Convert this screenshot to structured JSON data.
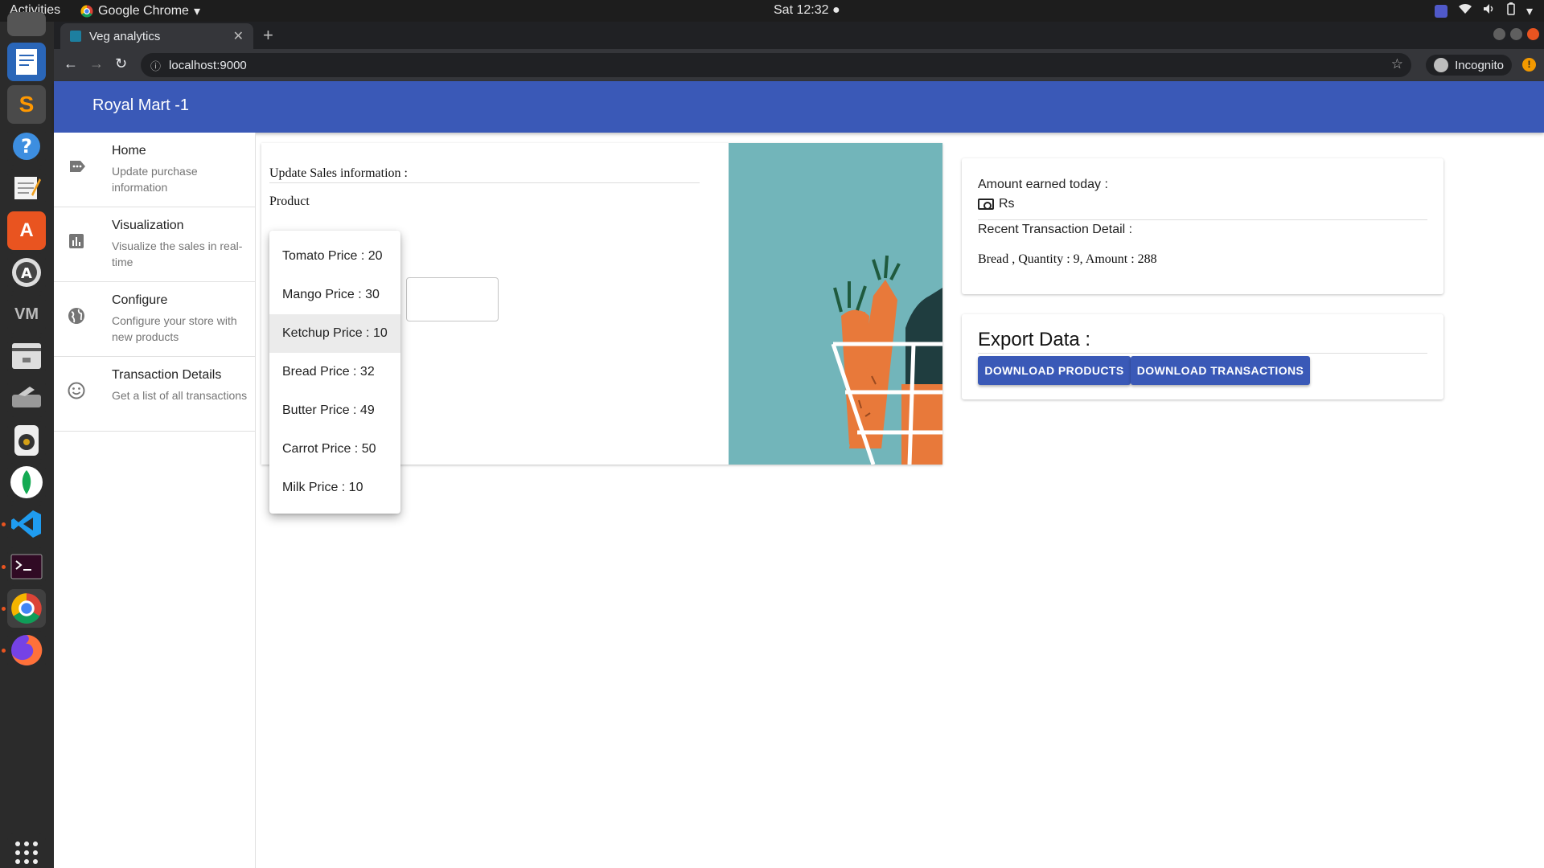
{
  "topbar": {
    "activities": "Activities",
    "app_name": "Google Chrome",
    "clock": "Sat 12:32"
  },
  "dock": {
    "items": [
      "text-editor",
      "sublime-text",
      "help",
      "notes",
      "software-center",
      "software-updater",
      "vim",
      "files",
      "scanner",
      "music",
      "mongodb",
      "vscode",
      "terminal",
      "chrome",
      "firefox",
      "apps-grid"
    ]
  },
  "browser": {
    "tab_title": "Veg analytics",
    "url": "localhost:9000",
    "incognito_label": "Incognito"
  },
  "app": {
    "title": "Royal Mart -1"
  },
  "nav": {
    "items": [
      {
        "title": "Home",
        "subtitle": "Update purchase information",
        "icon": "label-icon"
      },
      {
        "title": "Visualization",
        "subtitle": "Visualize the sales in real-time",
        "icon": "bar-chart-icon"
      },
      {
        "title": "Configure",
        "subtitle": "Configure your store with new products",
        "icon": "globe-icon"
      },
      {
        "title": "Transaction Details",
        "subtitle": "Get a list of all transactions",
        "icon": "smiley-icon"
      }
    ]
  },
  "sales": {
    "heading": "Update Sales information :",
    "product_label": "Product"
  },
  "dropdown": {
    "selected_index": 2,
    "options": [
      "Tomato Price : 20",
      "Mango Price : 30",
      "Ketchup Price : 10",
      "Bread Price : 32",
      "Butter Price : 49",
      "Carrot Price : 50",
      "Milk Price : 10"
    ]
  },
  "amount": {
    "label": "Amount earned today :",
    "currency": "Rs",
    "recent_label": "Recent Transaction Detail :",
    "recent_value": "Bread , Quantity : 9, Amount : 288"
  },
  "export": {
    "title": "Export Data :",
    "download_products": "DOWNLOAD PRODUCTS",
    "download_transactions": "DOWNLOAD TRANSACTIONS"
  },
  "colors": {
    "app_bar": "#3a59b7",
    "illustration_bg": "#72b5ba",
    "carrot": "#e8793a"
  }
}
